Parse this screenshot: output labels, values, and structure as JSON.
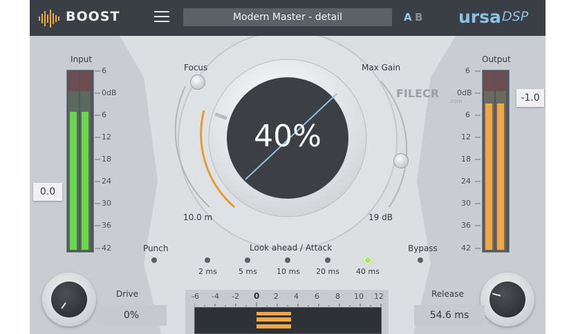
{
  "header": {
    "product": "BOOST",
    "preset": "Modern Master - detail",
    "ab_a": "A",
    "ab_b": "B",
    "brand": "ursa",
    "brand_suffix": "DSP",
    "menu_icon": "hamburger-menu-icon"
  },
  "input": {
    "label": "Input",
    "value": "0.0",
    "ticks": [
      "6",
      "0dB",
      "6",
      "12",
      "18",
      "24",
      "30",
      "36",
      "42"
    ],
    "level_left": 0.72,
    "level_right": 0.72
  },
  "output": {
    "label": "Output",
    "value": "-1.0",
    "ticks": [
      "6",
      "0dB",
      "6",
      "12",
      "18",
      "24",
      "30",
      "36",
      "42"
    ],
    "level_left": 0.82,
    "level_right": 0.82
  },
  "focus": {
    "label": "Focus",
    "value": "10.0 m"
  },
  "maxgain": {
    "label": "Max Gain",
    "value": "19 dB"
  },
  "main_knob": {
    "value": "40%"
  },
  "punch": {
    "label": "Punch"
  },
  "bypass": {
    "label": "Bypass"
  },
  "lookahead": {
    "label": "Look ahead / Attack",
    "options": [
      "2 ms",
      "5 ms",
      "10 ms",
      "20 ms",
      "40 ms"
    ],
    "selected": 4
  },
  "drive": {
    "label": "Drive",
    "value": "0%"
  },
  "release": {
    "label": "Release",
    "value": "54.6 ms"
  },
  "scale": {
    "ticks": [
      "-6",
      "-4",
      "-2",
      "0",
      "2",
      "4",
      "6",
      "8",
      "10",
      "12"
    ]
  },
  "watermark": {
    "text": "FILECR",
    "suffix": ".com"
  },
  "colors": {
    "accent_blue": "#8ac2e6",
    "input_green": "#65d94a",
    "output_orange": "#f0a74a",
    "gain_orange": "#e39b32",
    "led_on": "#a9e36a"
  }
}
